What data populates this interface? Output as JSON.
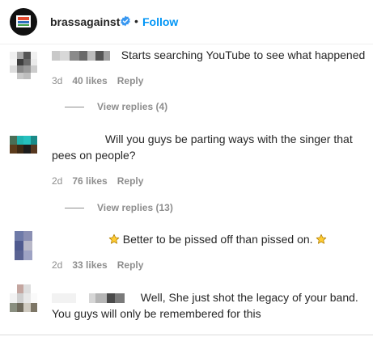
{
  "header": {
    "username": "brassagainst",
    "dot": "•",
    "follow_label": "Follow"
  },
  "comments": [
    {
      "text": "Starts searching YouTube to see what happened",
      "time": "3d",
      "likes": "40 likes",
      "reply": "Reply",
      "view_replies": "View replies (4)"
    },
    {
      "text_line1": "Will you guys be parting ways with the singer that",
      "text_line2": "pees on people?",
      "time": "2d",
      "likes": "76 likes",
      "reply": "Reply",
      "view_replies": "View replies (13)"
    },
    {
      "text": "Better to be pissed off than pissed on.",
      "time": "2d",
      "likes": "33 likes",
      "reply": "Reply"
    },
    {
      "text_line1": "Well, She just shot the legacy of your band.",
      "text_line2": "You guys will only be remembered for this"
    }
  ],
  "icons": {
    "verified": "verified-badge-icon",
    "star": "star-emoji-icon"
  },
  "colors": {
    "link_blue": "#0095f6",
    "meta_gray": "#8e8e8e",
    "text": "#262626"
  }
}
